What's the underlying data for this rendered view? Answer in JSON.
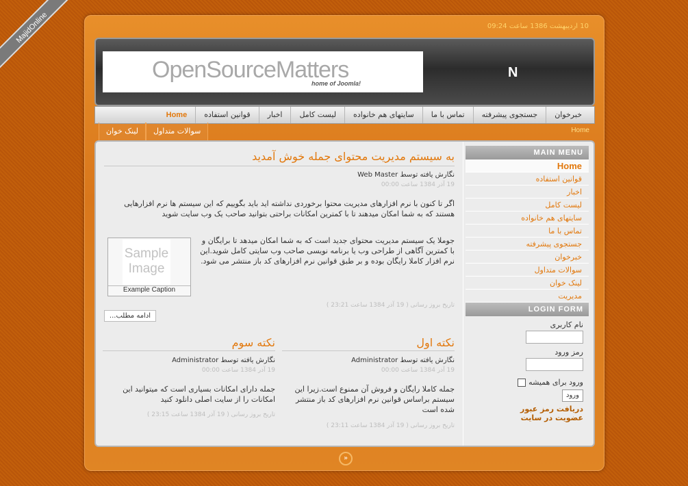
{
  "watermark": "MajidOnline",
  "header": {
    "date": "10 اردیبهشت 1386 ساعت 09:24",
    "logo_text": "OpenSourceMatters",
    "logo_sub": "home of Joomla!",
    "logo_letter": "N"
  },
  "topnav": {
    "items": [
      "خبرخوان",
      "جستجوی پیشرفته",
      "تماس با ما",
      "سایتهای هم خانواده",
      "لیست کامل",
      "اخبار",
      "قوانین استفاده",
      "Home"
    ]
  },
  "subnav": {
    "breadcrumb": "Home",
    "items": [
      "سوالات متداول",
      "لینک خوان"
    ]
  },
  "main_article": {
    "title": "به سیستم مدیریت محتوای جمله خوش آمدید",
    "author": "نگارش یافته توسط Web Master",
    "date": "19 آذر 1384 ساعت 00:00",
    "para1": "اگر تا کنون با نرم افزارهای مدیریت محتوا برخوردی نداشته اید باید بگوییم که این سیستم ها نرم افزارهایی هستند که به شما امکان میدهند تا با کمترین امکانات براحتی بتوانید صاحب یک وب سایت شوید",
    "para2": "جوملا یک سیستم مدیریت محتوای جدید است که به شما امکان میدهد تا برایگان و با کمترین آگاهی از طراحی وب یا برنامه نویسی صاحب وب سایتی کامل شوید.این نرم افزار کاملا رایگان بوده و بر طبق قوانین نرم افزارهای کد باز منتشر می شود.",
    "sample_image": "Sample Image",
    "caption": "Example Caption",
    "modified": "تاریخ بروز رسانی ( 19 آذر 1384 ساعت 23:21 )",
    "read_more": "ادامه مطلب..."
  },
  "col1": {
    "title": "نکته اول",
    "author": "نگارش یافته توسط Administrator",
    "date": "19 آذر 1384 ساعت 00:00",
    "text": "جمله کاملا رایگان و فروش آن ممنوع است.زیرا این سیستم براساس قوانین نرم افزارهای کد باز منتشر شده است",
    "modified": "تاریخ بروز رسانی ( 19 آذر 1384 ساعت 23:11 )"
  },
  "col2": {
    "title": "نکته سوم",
    "author": "نگارش یافته توسط Administrator",
    "date": "19 آذر 1384 ساعت 00:00",
    "text": "جمله دارای امکانات بسیاری است که میتوانید این امکانات را از سایت اصلی دانلود کنید",
    "modified": "تاریخ بروز رسانی ( 19 آذر 1384 ساعت 23:15 )"
  },
  "sidebar": {
    "menu_title": "MAIN MENU",
    "items": [
      "Home",
      "قوانین استفاده",
      "اخبار",
      "لیست کامل",
      "سایتهای هم خانواده",
      "تماس با ما",
      "جستجوی پیشرفته",
      "خبرخوان",
      "سوالات متداول",
      "لینک خوان",
      "مدیریت"
    ],
    "login_title": "LOGIN FORM",
    "username_label": "نام کاربری",
    "password_label": "رمز ورود",
    "remember_label": "ورود برای همیشه",
    "login_button": "ورود",
    "forgot_link": "دریافت رمز عبور",
    "register_link": "عضویت در سایت"
  },
  "footer": {
    "top_icon": "double-chevron-up-icon",
    "top_glyph": "»"
  }
}
